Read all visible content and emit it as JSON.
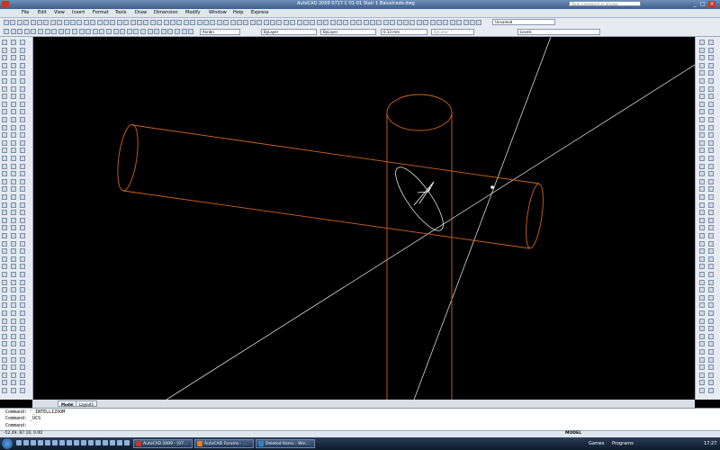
{
  "window": {
    "title": "AutoCAD 2009 0717 C 01-01 Stair 1 Balustrade.dwg",
    "search_placeholder": "Type a keyword or phrase",
    "minimize": "_",
    "maximize": "□",
    "close": "×"
  },
  "menu": [
    "File",
    "Edit",
    "View",
    "Insert",
    "Format",
    "Tools",
    "Draw",
    "Dimension",
    "Modify",
    "Window",
    "Help",
    "Express"
  ],
  "toolbar": {
    "annotation_style": "Annbn",
    "view_name": "Unnamed",
    "layer_combo": "ByLayer",
    "linetype_combo": "ByLayer",
    "lineweight_combo": "0.13 mm",
    "plotstyle_combo": "ByColor",
    "layer_name": "Levels"
  },
  "tabs": [
    "Model",
    "Layout1"
  ],
  "command_history": [
    "Command: '_INTELLIZOOM",
    "Command: _UCS"
  ],
  "command_prompt": "Command:",
  "status": {
    "coordinates": "-52.49, 87.10, 0.00",
    "model_label": "MODEL"
  },
  "taskbar": {
    "items": [
      {
        "label": "AutoCAD 2009 - [07...",
        "color": "#c0392b"
      },
      {
        "label": "AutoCAD Forums - ...",
        "color": "#e67e22"
      },
      {
        "label": "Deleted Items - Win...",
        "color": "#2e86c1"
      }
    ],
    "games_label": "Games",
    "programs_label": "Programs",
    "clock": "17:27"
  },
  "colors": {
    "drawing_orange": "#d4641a",
    "construction_line": "#d8d8d8",
    "ucs_icon": "#ffffff"
  }
}
